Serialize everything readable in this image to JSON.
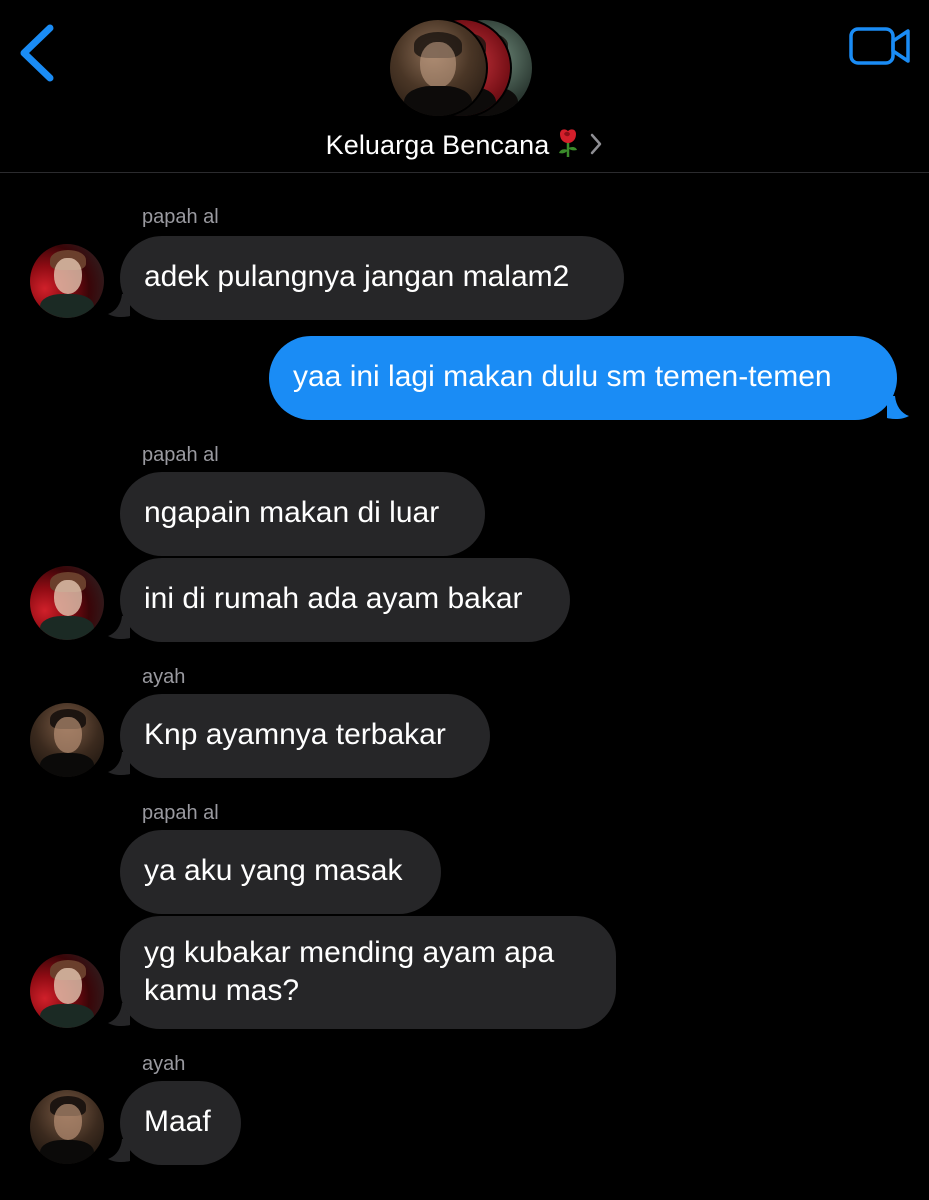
{
  "header": {
    "group_name": "Keluarga Bencana",
    "back_icon": "chevron-left-icon",
    "video_icon": "video-camera-icon",
    "title_emoji_icon": "rose-icon",
    "title_chevron_icon": "chevron-right-icon"
  },
  "colors": {
    "accent": "#1a8cf5",
    "incoming_bubble": "#262628",
    "background": "#000000",
    "sender_label": "#9a9aa0"
  },
  "messages": [
    {
      "sender": "papah al",
      "text": "adek pulangnya jangan malam2"
    },
    {
      "sender": "",
      "direction": "outgoing",
      "text": "yaa ini lagi makan dulu sm temen-temen"
    },
    {
      "sender": "papah al",
      "text": "ngapain makan di luar"
    },
    {
      "sender": "papah al",
      "text": "ini di rumah ada ayam bakar"
    },
    {
      "sender": "ayah",
      "text": "Knp ayamnya terbakar"
    },
    {
      "sender": "papah al",
      "text": "ya aku yang masak"
    },
    {
      "sender": "papah al",
      "text": "yg kubakar mending ayam apa kamu mas?"
    },
    {
      "sender": "ayah",
      "text": "Maaf"
    }
  ]
}
